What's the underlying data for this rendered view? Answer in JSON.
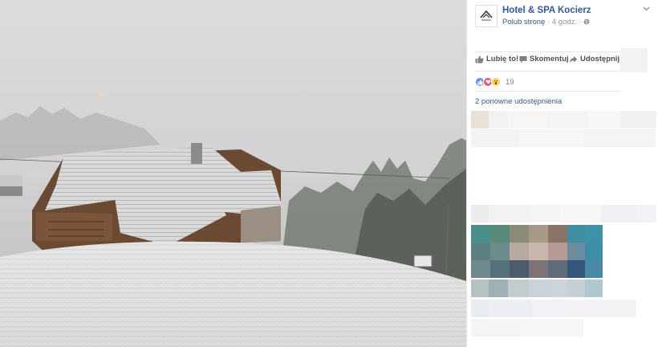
{
  "page": {
    "name": "Hotel & SPA Kocierz",
    "like_page_link": "Polub stronę",
    "separator": "·",
    "time_ago": "4 godz.",
    "logo_text": "HOTEL & SPA"
  },
  "actions": {
    "like": "Lubię to!",
    "comment": "Skomentuj",
    "share": "Udostępnij"
  },
  "reactions": {
    "icons": [
      "like-icon",
      "love-icon",
      "wow-icon"
    ],
    "count": "19"
  },
  "shares_text": "2 ponowne udostępnienia",
  "colors": {
    "link": "#365899",
    "meta": "#90949c",
    "like_blue": "#5890ff",
    "love_red": "#f25268",
    "wow_yellow": "#fdd15e"
  }
}
